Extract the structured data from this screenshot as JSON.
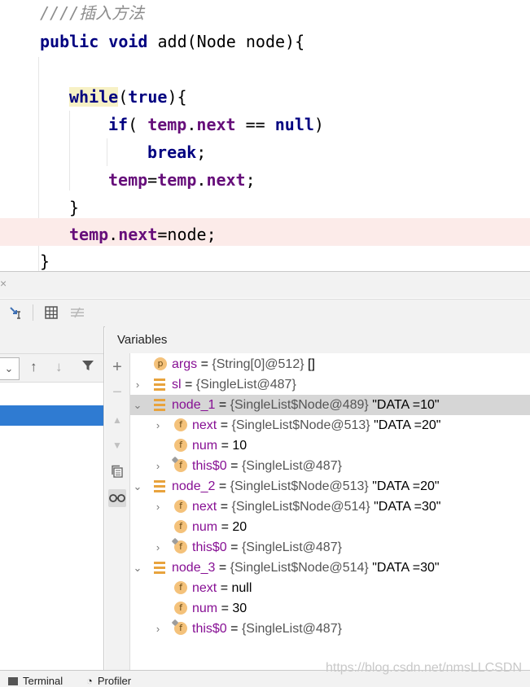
{
  "editor": {
    "comment": "////插入方法",
    "lines": {
      "sig": {
        "kw1": "public",
        "kw2": "void",
        "rest": "add(Node node){"
      },
      "while": {
        "kw": "while",
        "paren_open": "(",
        "kw_true": "true",
        "paren_close": "){"
      },
      "if": {
        "kw": "if",
        "p1": "( ",
        "temp": "temp",
        "dot": ".",
        "next": "next",
        "op": " == ",
        "null": "null",
        "p2": ")"
      },
      "break": {
        "kw": "break",
        "semi": ";"
      },
      "assign": {
        "temp1": "temp",
        "eq": "=",
        "temp2": "temp",
        "dot": ".",
        "next": "next",
        "semi": ";"
      },
      "close_while": "}",
      "link": {
        "temp": "temp",
        "dot": ".",
        "next": "next",
        "rest": "=node;"
      },
      "close_method": "}"
    }
  },
  "panel": {
    "close_glyph": "×",
    "variables_title": "Variables"
  },
  "variables": [
    {
      "arrow": "",
      "icon": "p",
      "name": "args",
      "eq": " = ",
      "type": "{String[0]@512}",
      "val": " []"
    },
    {
      "arrow": "›",
      "icon": "fieldbars",
      "name": "sl",
      "eq": " = ",
      "type": "{SingleList@487}",
      "val": ""
    },
    {
      "arrow": "⌄",
      "icon": "fieldbars",
      "name": "node_1",
      "eq": " = ",
      "type": "{SingleList$Node@489}",
      "val": " \"DATA =10\""
    },
    {
      "arrow": "›",
      "icon": "f",
      "name": "next",
      "eq": " = ",
      "type": "{SingleList$Node@513}",
      "val": " \"DATA =20\""
    },
    {
      "arrow": "",
      "icon": "f",
      "name": "num",
      "eq": " = ",
      "type": "",
      "val": "10"
    },
    {
      "arrow": "›",
      "icon": "ffin",
      "name": "this$0",
      "eq": " = ",
      "type": "{SingleList@487}",
      "val": ""
    },
    {
      "arrow": "⌄",
      "icon": "fieldbars",
      "name": "node_2",
      "eq": " = ",
      "type": "{SingleList$Node@513}",
      "val": " \"DATA =20\""
    },
    {
      "arrow": "›",
      "icon": "f",
      "name": "next",
      "eq": " = ",
      "type": "{SingleList$Node@514}",
      "val": " \"DATA =30\""
    },
    {
      "arrow": "",
      "icon": "f",
      "name": "num",
      "eq": " = ",
      "type": "",
      "val": "20"
    },
    {
      "arrow": "›",
      "icon": "ffin",
      "name": "this$0",
      "eq": " = ",
      "type": "{SingleList@487}",
      "val": ""
    },
    {
      "arrow": "⌄",
      "icon": "fieldbars",
      "name": "node_3",
      "eq": " = ",
      "type": "{SingleList$Node@514}",
      "val": " \"DATA =30\""
    },
    {
      "arrow": "",
      "icon": "f",
      "name": "next",
      "eq": " = ",
      "type": "",
      "val": "null"
    },
    {
      "arrow": "",
      "icon": "f",
      "name": "num",
      "eq": " = ",
      "type": "",
      "val": "30"
    },
    {
      "arrow": "›",
      "icon": "ffin",
      "name": "this$0",
      "eq": " = ",
      "type": "{SingleList@487}",
      "val": ""
    }
  ],
  "status": {
    "terminal": "Terminal",
    "profiler": "Profiler"
  },
  "watermark": "https://blog.csdn.net/nmsLLCSDN"
}
